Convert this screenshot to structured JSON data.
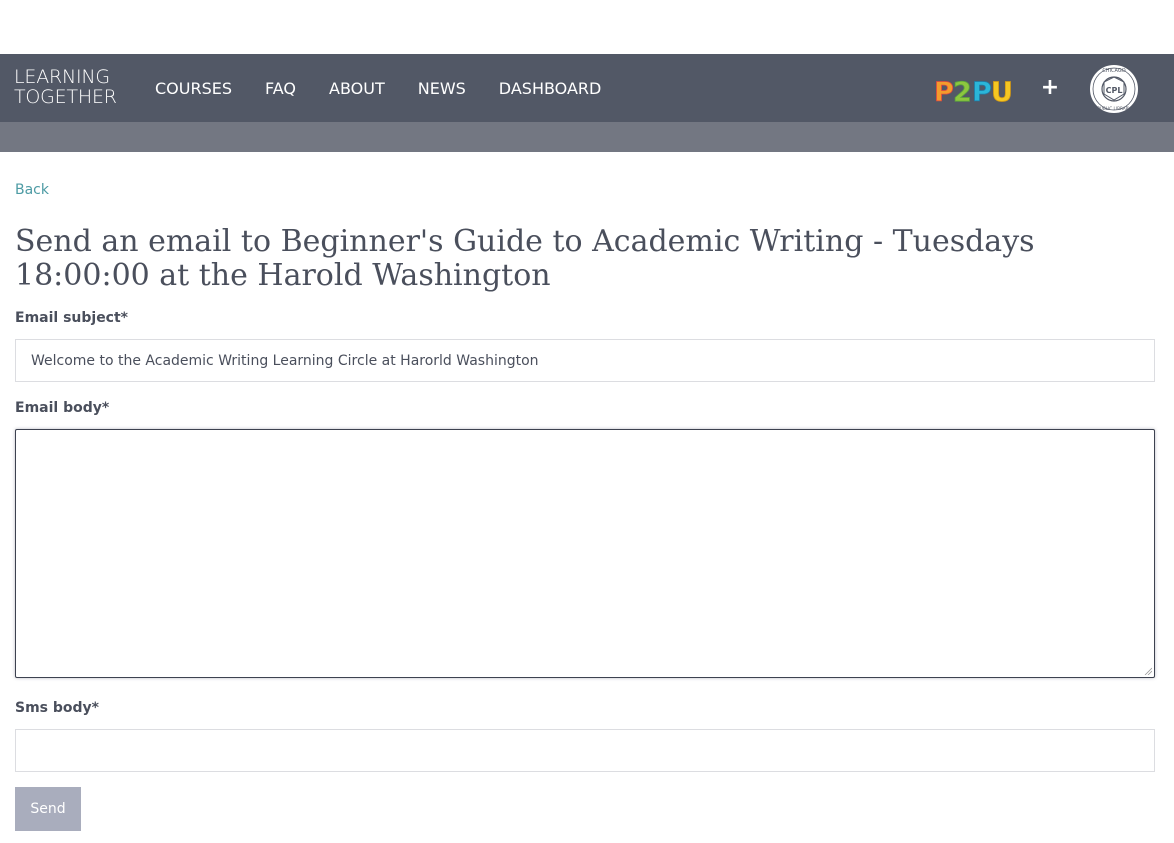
{
  "logo": {
    "line1": "LEARNING",
    "line2": "TOGETHER"
  },
  "nav": {
    "items": [
      {
        "label": "COURSES"
      },
      {
        "label": "FAQ"
      },
      {
        "label": "ABOUT"
      },
      {
        "label": "NEWS"
      },
      {
        "label": "DASHBOARD"
      }
    ],
    "partner_logo_text": "P2PU",
    "plus": "+",
    "library_logo_text": "CHICAGO PUBLIC LIBRARY",
    "library_initials": "CPL"
  },
  "page": {
    "back_label": "Back",
    "title": "Send an email to Beginner's Guide to Academic Writing - Tuesdays 18:00:00 at the Harold Washington"
  },
  "form": {
    "subject_label": "Email subject*",
    "subject_value": "Welcome to the Academic Writing Learning Circle at Harorld Washington",
    "body_label": "Email body*",
    "body_value": "",
    "sms_label": "Sms body*",
    "sms_value": "",
    "send_label": "Send"
  },
  "colors": {
    "navbar": "#525866",
    "subbar": "#737782",
    "link": "#4d9ba4",
    "send_button": "#a9adbd"
  }
}
